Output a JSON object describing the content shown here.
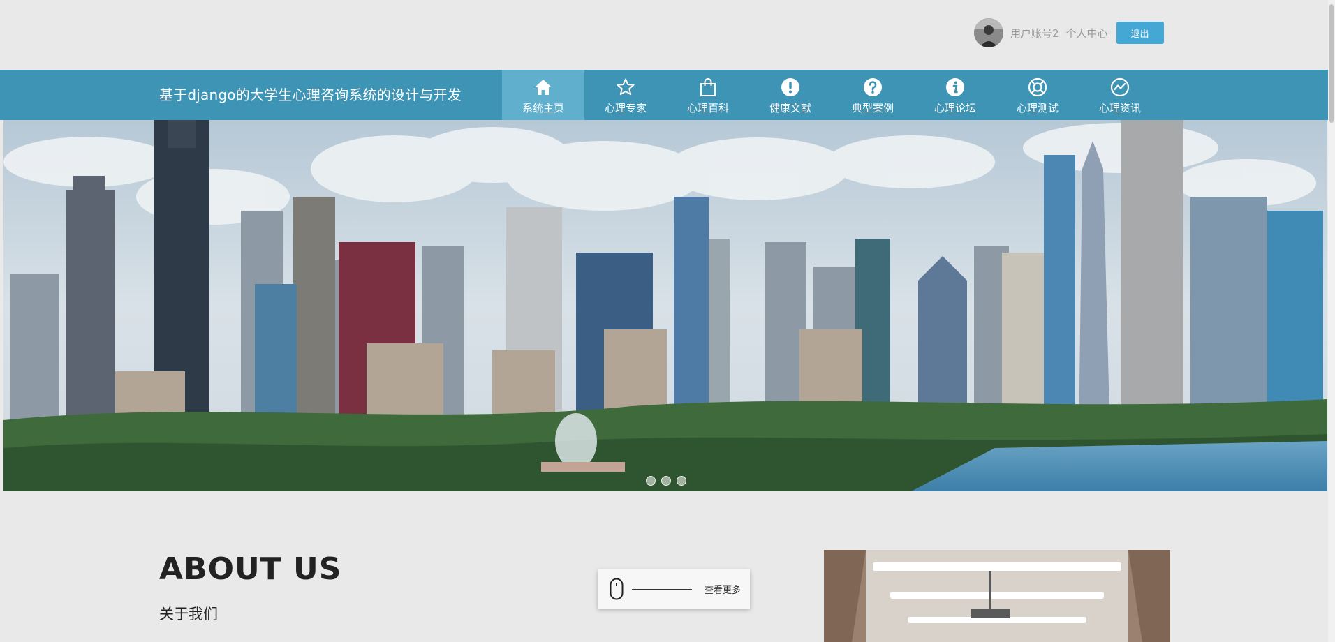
{
  "user": {
    "account": "用户账号2",
    "center": "个人中心",
    "logout": "退出"
  },
  "header": {
    "site_title": "基于django的大学生心理咨询系统的设计与开发"
  },
  "nav": {
    "items": [
      {
        "label": "系统主页",
        "icon": "home-icon",
        "active": true
      },
      {
        "label": "心理专家",
        "icon": "star-icon"
      },
      {
        "label": "心理百科",
        "icon": "shopping-bag-icon"
      },
      {
        "label": "健康文献",
        "icon": "exclamation-icon"
      },
      {
        "label": "典型案例",
        "icon": "question-icon"
      },
      {
        "label": "心理论坛",
        "icon": "info-icon"
      },
      {
        "label": "心理测试",
        "icon": "lifebuoy-icon"
      },
      {
        "label": "心理资讯",
        "icon": "chart-circle-icon"
      }
    ]
  },
  "banner": {
    "slides": 3,
    "current": 1
  },
  "about": {
    "title": "ABOUT US",
    "subtitle": "关于我们",
    "more": "查看更多"
  },
  "colors": {
    "nav_bg": "#3d94b5",
    "nav_active": "#5fafcd",
    "logout_bg": "#45a8d4",
    "page_bg": "#e9e9e9"
  }
}
